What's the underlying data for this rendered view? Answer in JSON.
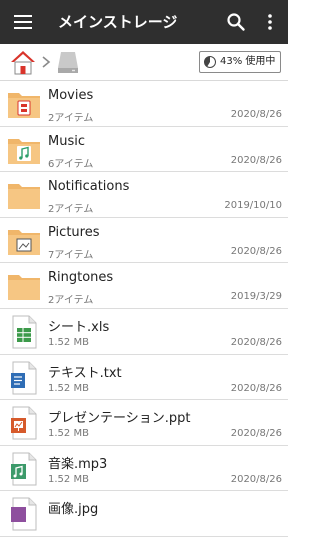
{
  "app": {
    "title": "メインストレージ"
  },
  "usage": {
    "label": "43% 使用中",
    "percent": 43
  },
  "colors": {
    "appbar": "#2f2f2f",
    "folder": "#f0b66a",
    "home_roof": "#d9342b"
  },
  "items": [
    {
      "name": "Movies",
      "detail": "2アイテム",
      "date": "2020/8/26",
      "icon": "folder-movie-icon"
    },
    {
      "name": "Music",
      "detail": "6アイテム",
      "date": "2020/8/26",
      "icon": "folder-music-icon"
    },
    {
      "name": "Notifications",
      "detail": "2アイテム",
      "date": "2019/10/10",
      "icon": "folder-icon"
    },
    {
      "name": "Pictures",
      "detail": "7アイテム",
      "date": "2020/8/26",
      "icon": "folder-picture-icon"
    },
    {
      "name": "Ringtones",
      "detail": "2アイテム",
      "date": "2019/3/29",
      "icon": "folder-icon"
    },
    {
      "name": "シート.xls",
      "detail": "1.52 MB",
      "date": "2020/8/26",
      "icon": "spreadsheet-file-icon"
    },
    {
      "name": "テキスト.txt",
      "detail": "1.52 MB",
      "date": "2020/8/26",
      "icon": "text-file-icon"
    },
    {
      "name": "プレゼンテーション.ppt",
      "detail": "1.52 MB",
      "date": "2020/8/26",
      "icon": "presentation-file-icon"
    },
    {
      "name": "音楽.mp3",
      "detail": "1.52 MB",
      "date": "2020/8/26",
      "icon": "audio-file-icon"
    },
    {
      "name": "画像.jpg",
      "detail": "",
      "date": "",
      "icon": "image-file-icon"
    }
  ]
}
